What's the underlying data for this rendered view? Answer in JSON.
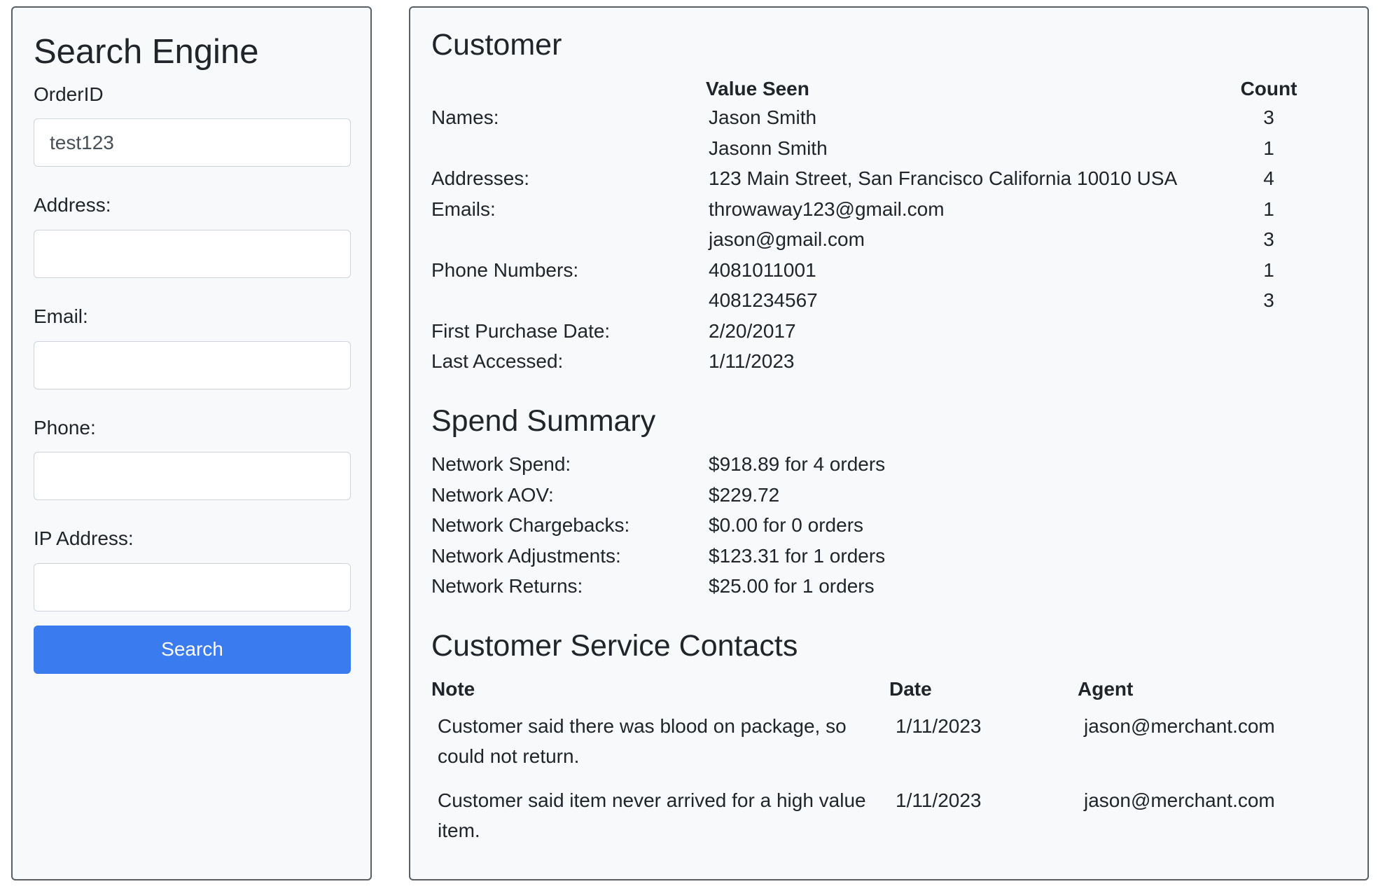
{
  "search_panel": {
    "title": "Search Engine",
    "order_id_label": "OrderID",
    "order_id_value": "test123",
    "address_label": "Address:",
    "address_value": "",
    "email_label": "Email:",
    "email_value": "",
    "phone_label": "Phone:",
    "phone_value": "",
    "ip_label": "IP Address:",
    "ip_value": "",
    "search_button": "Search"
  },
  "customer": {
    "title": "Customer",
    "headers": {
      "value_seen": "Value Seen",
      "count": "Count"
    },
    "rows": [
      {
        "label": "Names:",
        "value": "Jason Smith",
        "count": "3"
      },
      {
        "label": "",
        "value": "Jasonn Smith",
        "count": "1"
      },
      {
        "label": "Addresses:",
        "value": "123 Main Street, San Francisco California 10010 USA",
        "count": "4"
      },
      {
        "label": "Emails:",
        "value": "throwaway123@gmail.com",
        "count": "1"
      },
      {
        "label": "",
        "value": "jason@gmail.com",
        "count": "3"
      },
      {
        "label": "Phone Numbers:",
        "value": "4081011001",
        "count": "1"
      },
      {
        "label": "",
        "value": "4081234567",
        "count": "3"
      },
      {
        "label": "First Purchase Date:",
        "value": "2/20/2017",
        "count": ""
      },
      {
        "label": "Last Accessed:",
        "value": "1/11/2023",
        "count": ""
      }
    ]
  },
  "spend_summary": {
    "title": "Spend Summary",
    "rows": [
      {
        "label": "Network Spend:",
        "value": "$918.89 for 4 orders"
      },
      {
        "label": "Network AOV:",
        "value": "$229.72"
      },
      {
        "label": "Network Chargebacks:",
        "value": "$0.00 for 0 orders"
      },
      {
        "label": "Network Adjustments:",
        "value": "$123.31 for 1 orders"
      },
      {
        "label": "Network Returns:",
        "value": "$25.00 for 1 orders"
      }
    ]
  },
  "contacts": {
    "title": "Customer Service Contacts",
    "headers": {
      "note": "Note",
      "date": "Date",
      "agent": "Agent"
    },
    "rows": [
      {
        "note": "Customer said there was blood on package, so could not return.",
        "date": "1/11/2023",
        "agent": "jason@merchant.com"
      },
      {
        "note": "Customer said item never arrived for a high value item.",
        "date": "1/11/2023",
        "agent": "jason@merchant.com"
      }
    ]
  }
}
